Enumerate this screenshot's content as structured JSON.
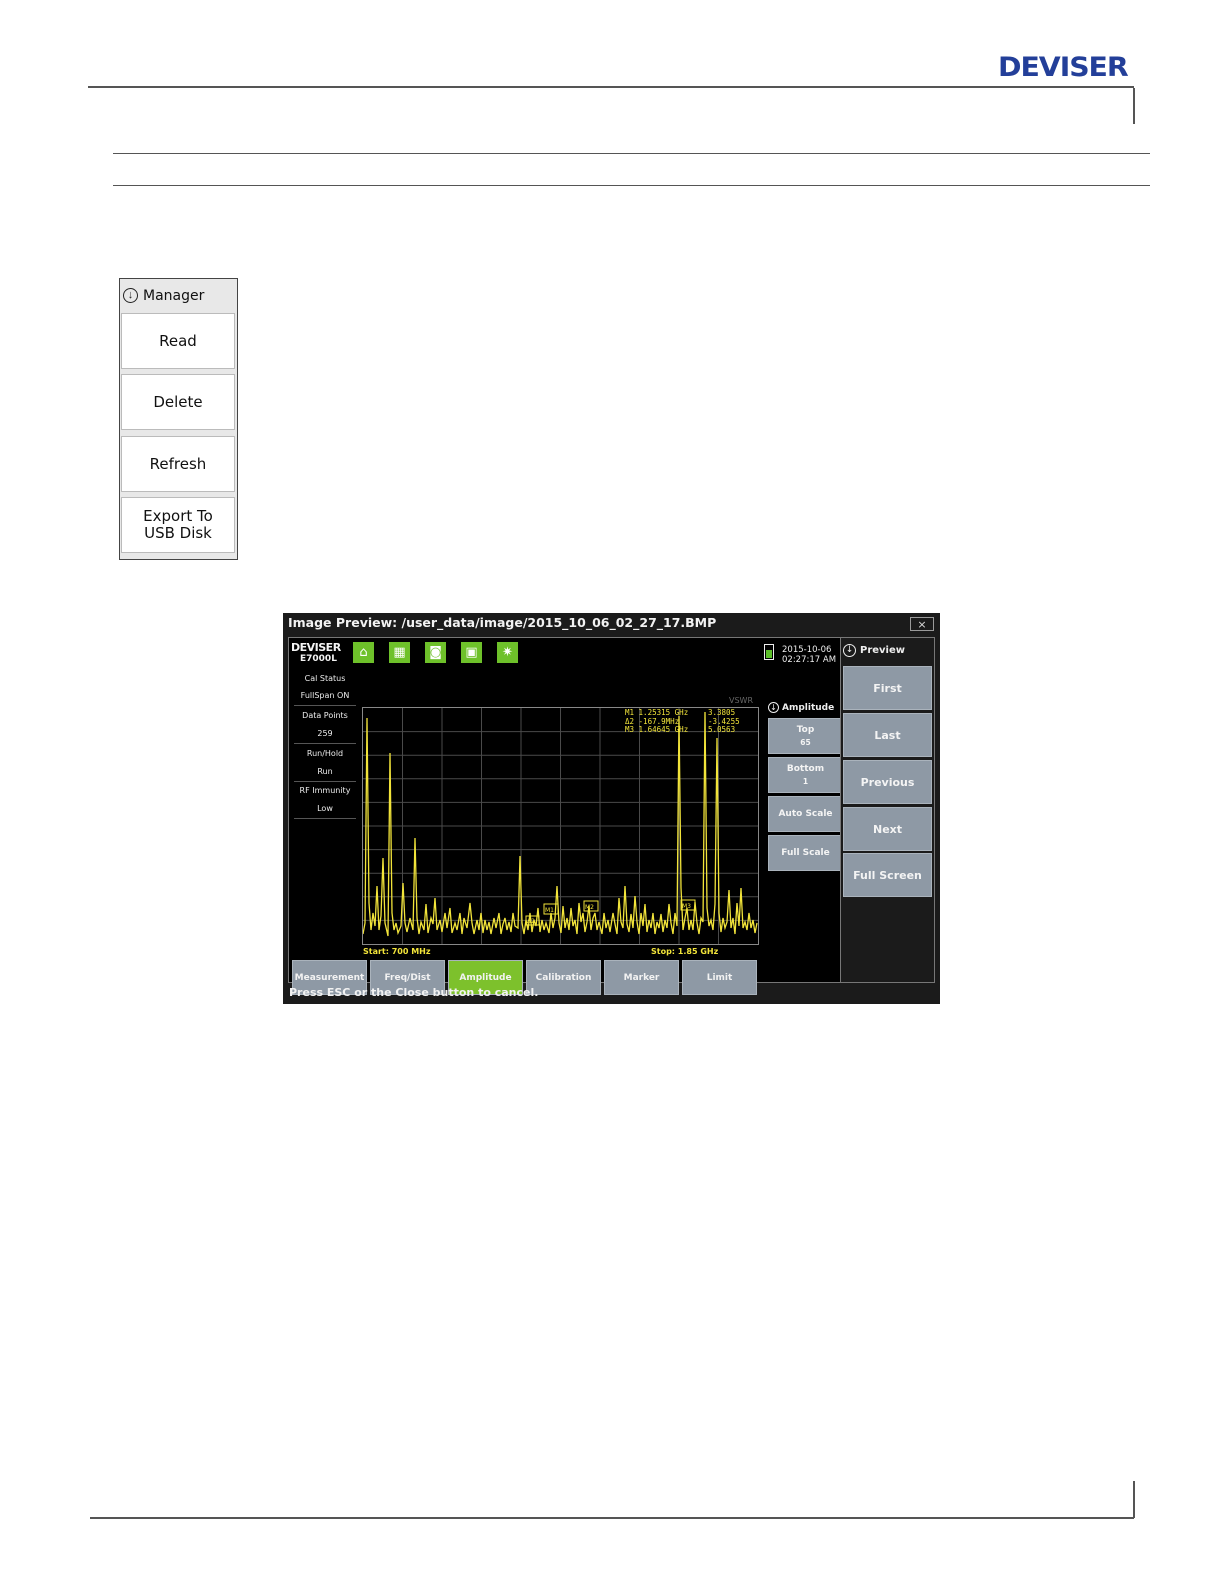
{
  "header": {
    "brand": "DEVISER"
  },
  "manager_menu": {
    "title": "Manager",
    "buttons": [
      "Read",
      "Delete",
      "Refresh",
      "Export To\nUSB Disk"
    ]
  },
  "device": {
    "window_title": "Image Preview:  /user_data/image/2015_10_06_02_27_17.BMP",
    "close_label": "×",
    "brand": "DEVISER",
    "model": "E7000L",
    "toolbar_icons": [
      "home-icon",
      "grid-icon",
      "camera-icon",
      "save-icon",
      "brightness-icon"
    ],
    "date": "2015-10-06",
    "time": "02:27:17 AM",
    "status": [
      {
        "label": "Cal Status",
        "value": "FullSpan ON"
      },
      {
        "label": "Data Points",
        "value": "259"
      },
      {
        "label": "Run/Hold",
        "value": "Run"
      },
      {
        "label": "RF Immunity",
        "value": "Low"
      }
    ],
    "measurement_type": "VSWR",
    "start_label": "Start: 700 MHz",
    "stop_label": "Stop: 1.85 GHz",
    "markers": [
      {
        "name": "M1",
        "freq": "1.25315 GHz",
        "value": "3.3805"
      },
      {
        "name": "Δ2",
        "freq": "-167.9MHz",
        "value": "-3.4255"
      },
      {
        "name": "M3",
        "freq": "1.64645 GHz",
        "value": "5.0563"
      }
    ],
    "bottom_tabs": [
      "Measurement",
      "Freq/Dist",
      "Amplitude",
      "Calibration",
      "Marker",
      "Limit"
    ],
    "active_tab": "Amplitude",
    "amplitude_menu": {
      "title": "Amplitude",
      "top_label": "Top",
      "top_value": "65",
      "bottom_label": "Bottom",
      "bottom_value": "1",
      "auto_scale": "Auto Scale",
      "full_scale": "Full Scale"
    },
    "preview_menu": {
      "title": "Preview",
      "buttons": [
        "First",
        "Last",
        "Previous",
        "Next",
        "Full Screen"
      ]
    },
    "status_message": "Press ESC or the Close button to cancel.",
    "accent_green": "#7dc12c",
    "trace_color": "#f2e43a"
  }
}
